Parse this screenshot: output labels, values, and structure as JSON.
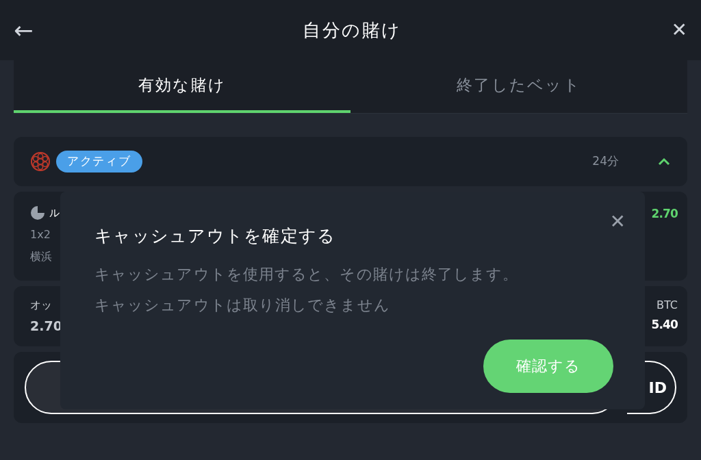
{
  "header": {
    "back": "←",
    "title": "自分の賭け",
    "close": "✕"
  },
  "tabs": [
    {
      "label": "有効な賭け",
      "selected": true
    },
    {
      "label": "終了したベット",
      "selected": false
    }
  ],
  "bet": {
    "status": "アクティブ",
    "time": "24分",
    "expanded": true,
    "selection": {
      "name": "ル",
      "odds": "2.70",
      "market": "1x2",
      "match": "横浜"
    },
    "odds_label": "オッ",
    "odds_value": "2.70",
    "currency_label": "BTC",
    "payout": "5.40",
    "button_text": "ID"
  },
  "dialog": {
    "title": "キャッシュアウトを確定する",
    "close": "✕",
    "lines": [
      "キャッシュアウトを使用すると、その賭けは終了します。",
      "キャッシュアウトは取り消しできません"
    ],
    "confirm": "確認する"
  }
}
